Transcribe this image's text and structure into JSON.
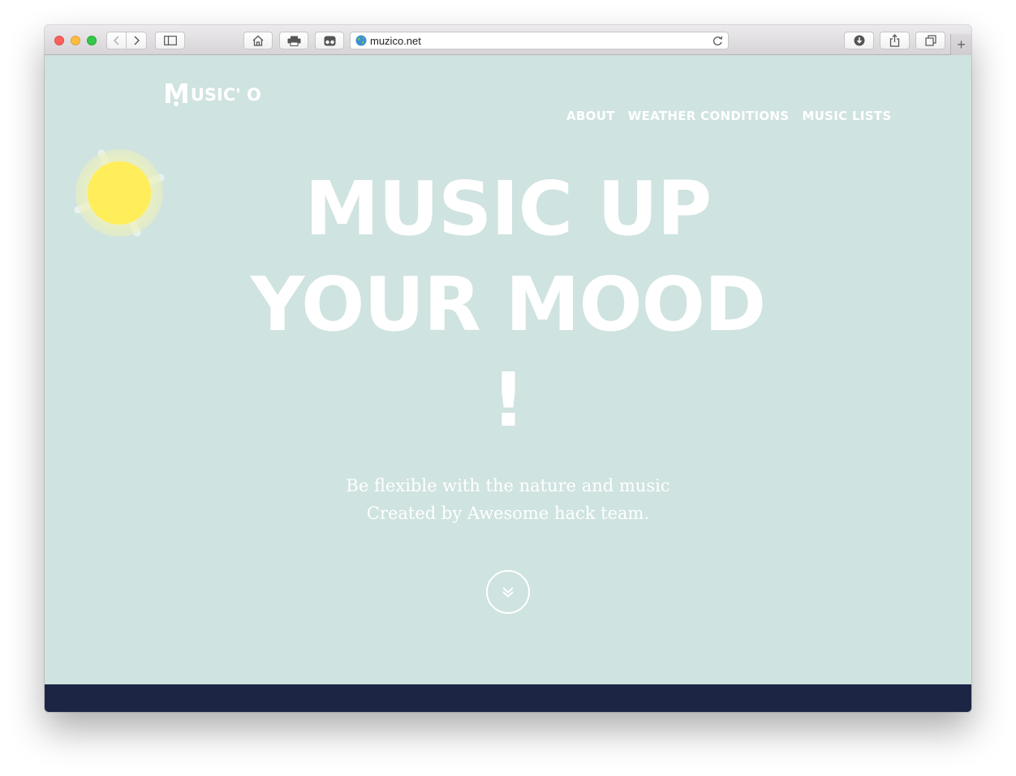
{
  "browser": {
    "url": "muzico.net",
    "new_tab_label": "+"
  },
  "site": {
    "logo": {
      "initial": "M",
      "rest": "USIC' O"
    },
    "nav": [
      {
        "label": "ABOUT"
      },
      {
        "label": "WEATHER CONDITIONS"
      },
      {
        "label": "MUSIC LISTS"
      }
    ],
    "hero": {
      "line1": "MUSIC UP",
      "line2": "YOUR MOOD",
      "line3": "!"
    },
    "tagline": {
      "line1": "Be flexible with the nature and music",
      "line2": "Created by Awesome hack team."
    }
  },
  "colors": {
    "page_background": "#cfe3e0",
    "footer_band": "#1c2644",
    "sun": "#ffee5a",
    "text": "#ffffff"
  },
  "icons": {
    "weather": "sun-icon",
    "scroll": "double-chevron-down-icon"
  }
}
